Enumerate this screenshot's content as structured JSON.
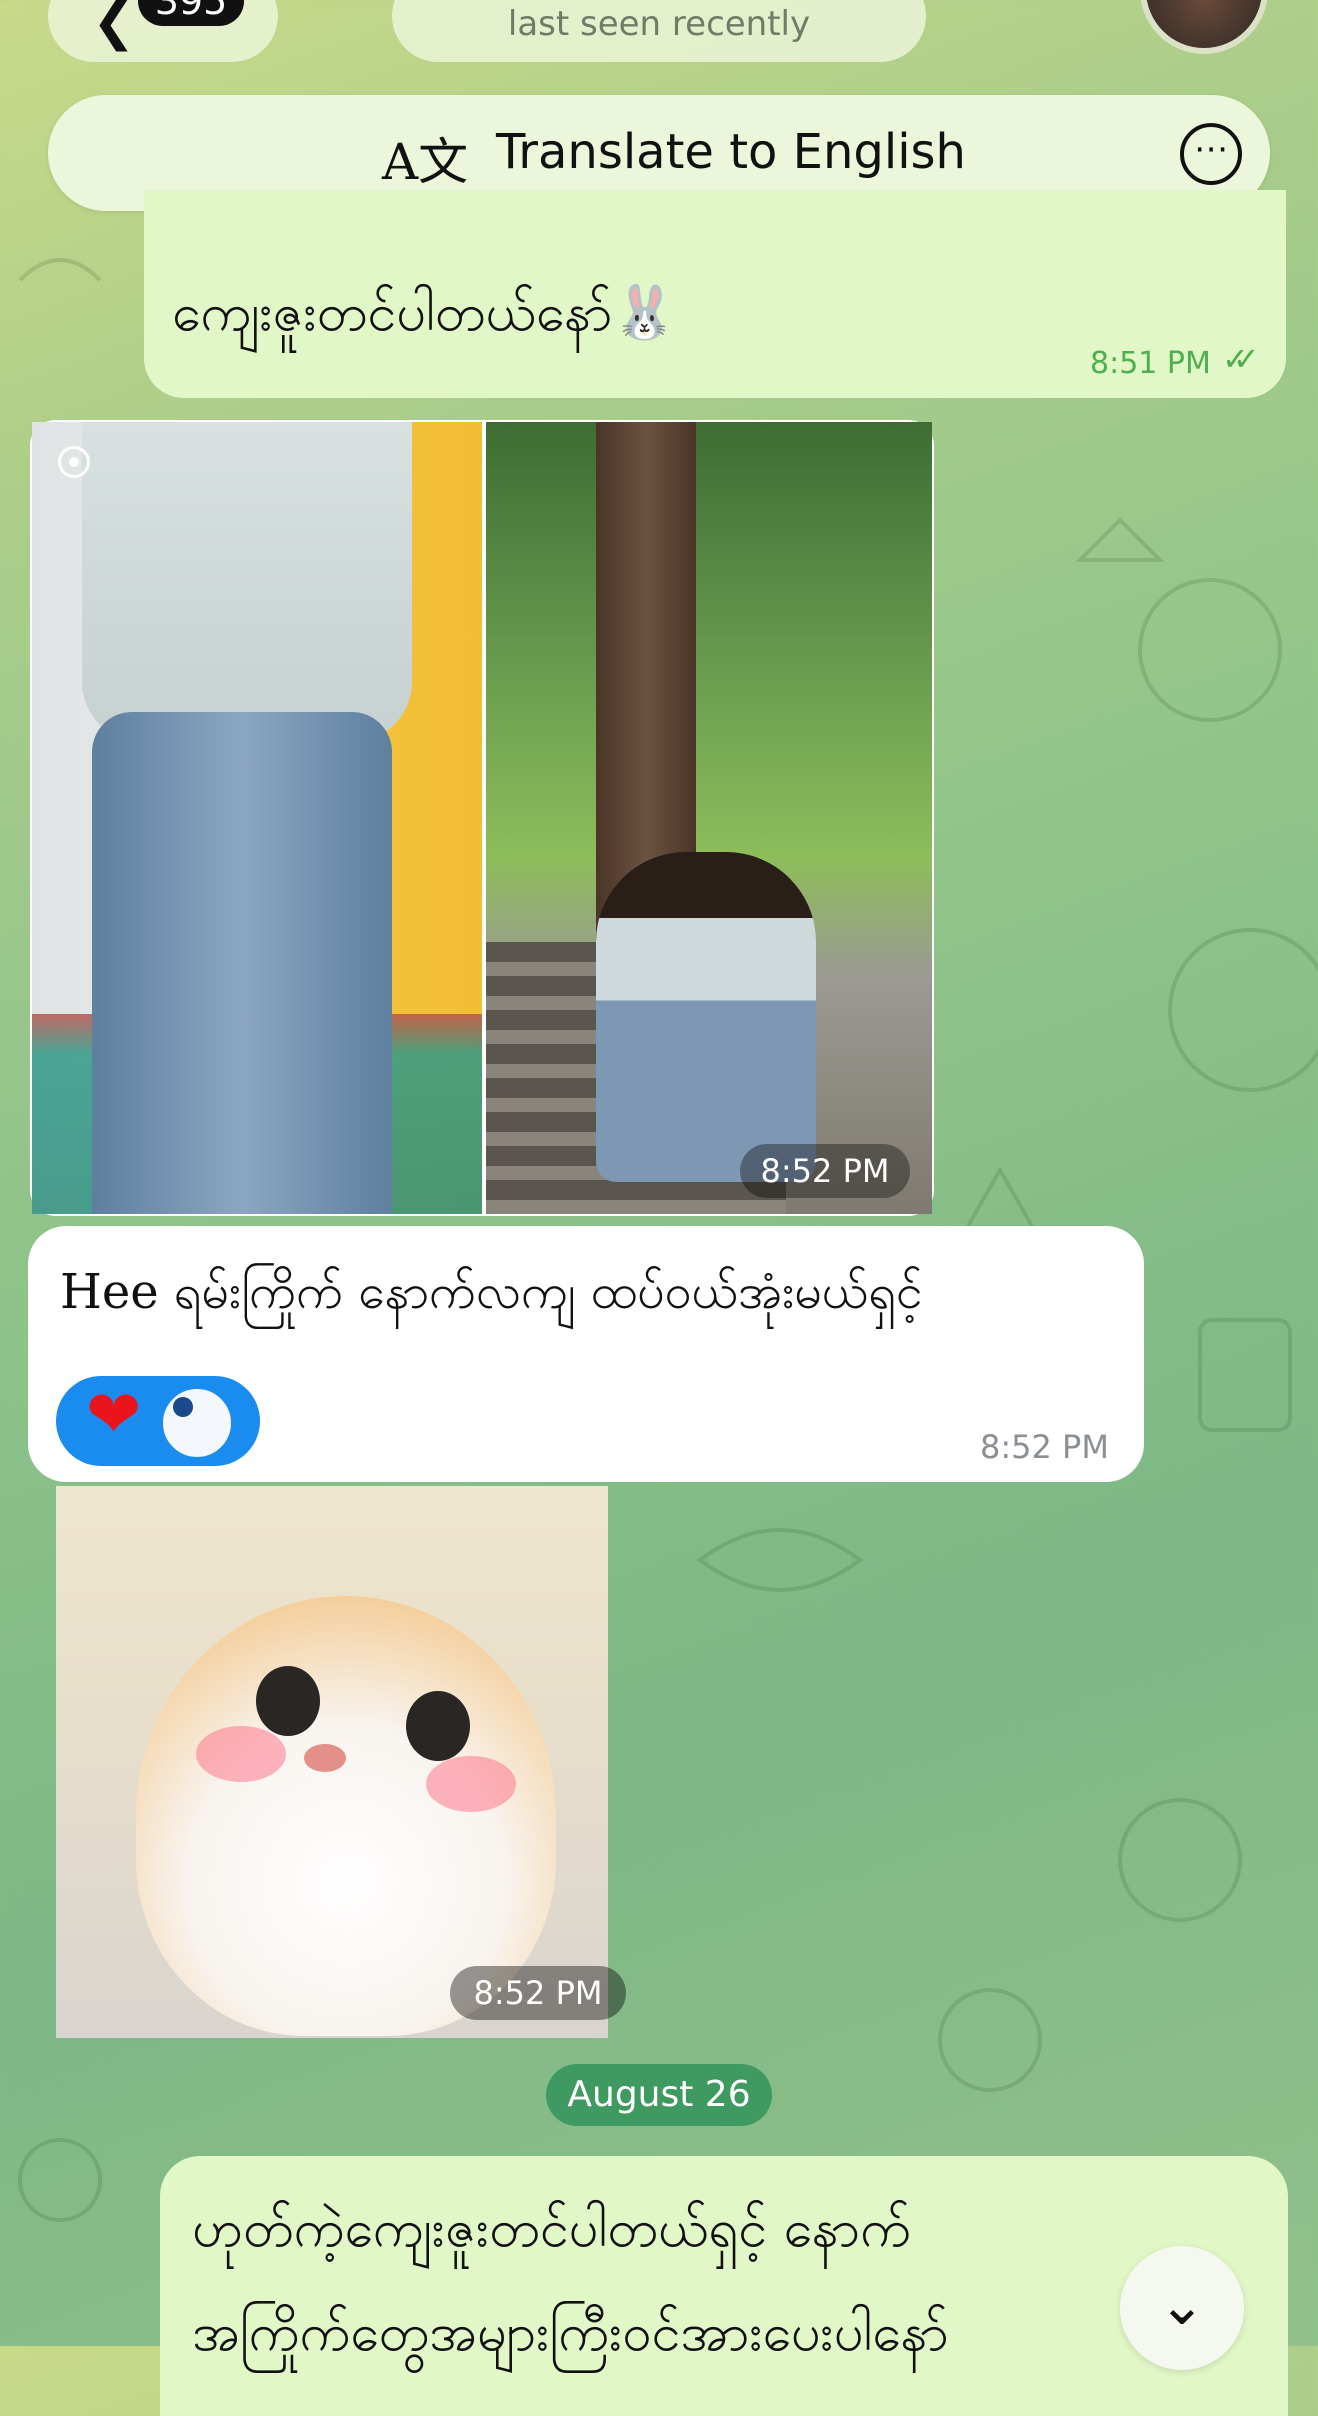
{
  "header": {
    "back_icon": "chevron-left-icon",
    "unread_count": "395",
    "status": "last seen recently"
  },
  "translate_bar": {
    "icon": "translate-icon",
    "label": "Translate to English",
    "more_icon": "more-horizontal-icon"
  },
  "messages": [
    {
      "direction": "outgoing",
      "type": "text",
      "text": "ကျေးဇူးတင်ပါတယ်နော်🐰",
      "time": "8:51 PM",
      "status_icon": "double-check-icon"
    },
    {
      "direction": "incoming",
      "type": "photo-album",
      "photos": 2,
      "time": "8:52 PM"
    },
    {
      "direction": "incoming",
      "type": "text",
      "text": "Hee  ရမ်းကြိုက် နောက်လကျ ထပ်ဝယ်အုံးမယ်ရှင့်",
      "reaction": "❤",
      "time": "8:52 PM"
    },
    {
      "direction": "incoming",
      "type": "sticker",
      "time": "8:52 PM"
    }
  ],
  "date_separator": "August 26",
  "last_message": {
    "direction": "outgoing",
    "line1": "ဟုတ်ကဲ့ကျေးဇူးတင်ပါတယ်ရှင့် နောက်",
    "line2": "အကြိုက်တွေအများကြီးဝင်အားပေးပါနော်"
  },
  "colors": {
    "outgoing_bubble": "#e2f7c8",
    "incoming_bubble": "#ffffff",
    "accent_green": "#4fae4e",
    "reaction_blue": "#1a8cf0",
    "date_pill": "#3f9a62"
  }
}
